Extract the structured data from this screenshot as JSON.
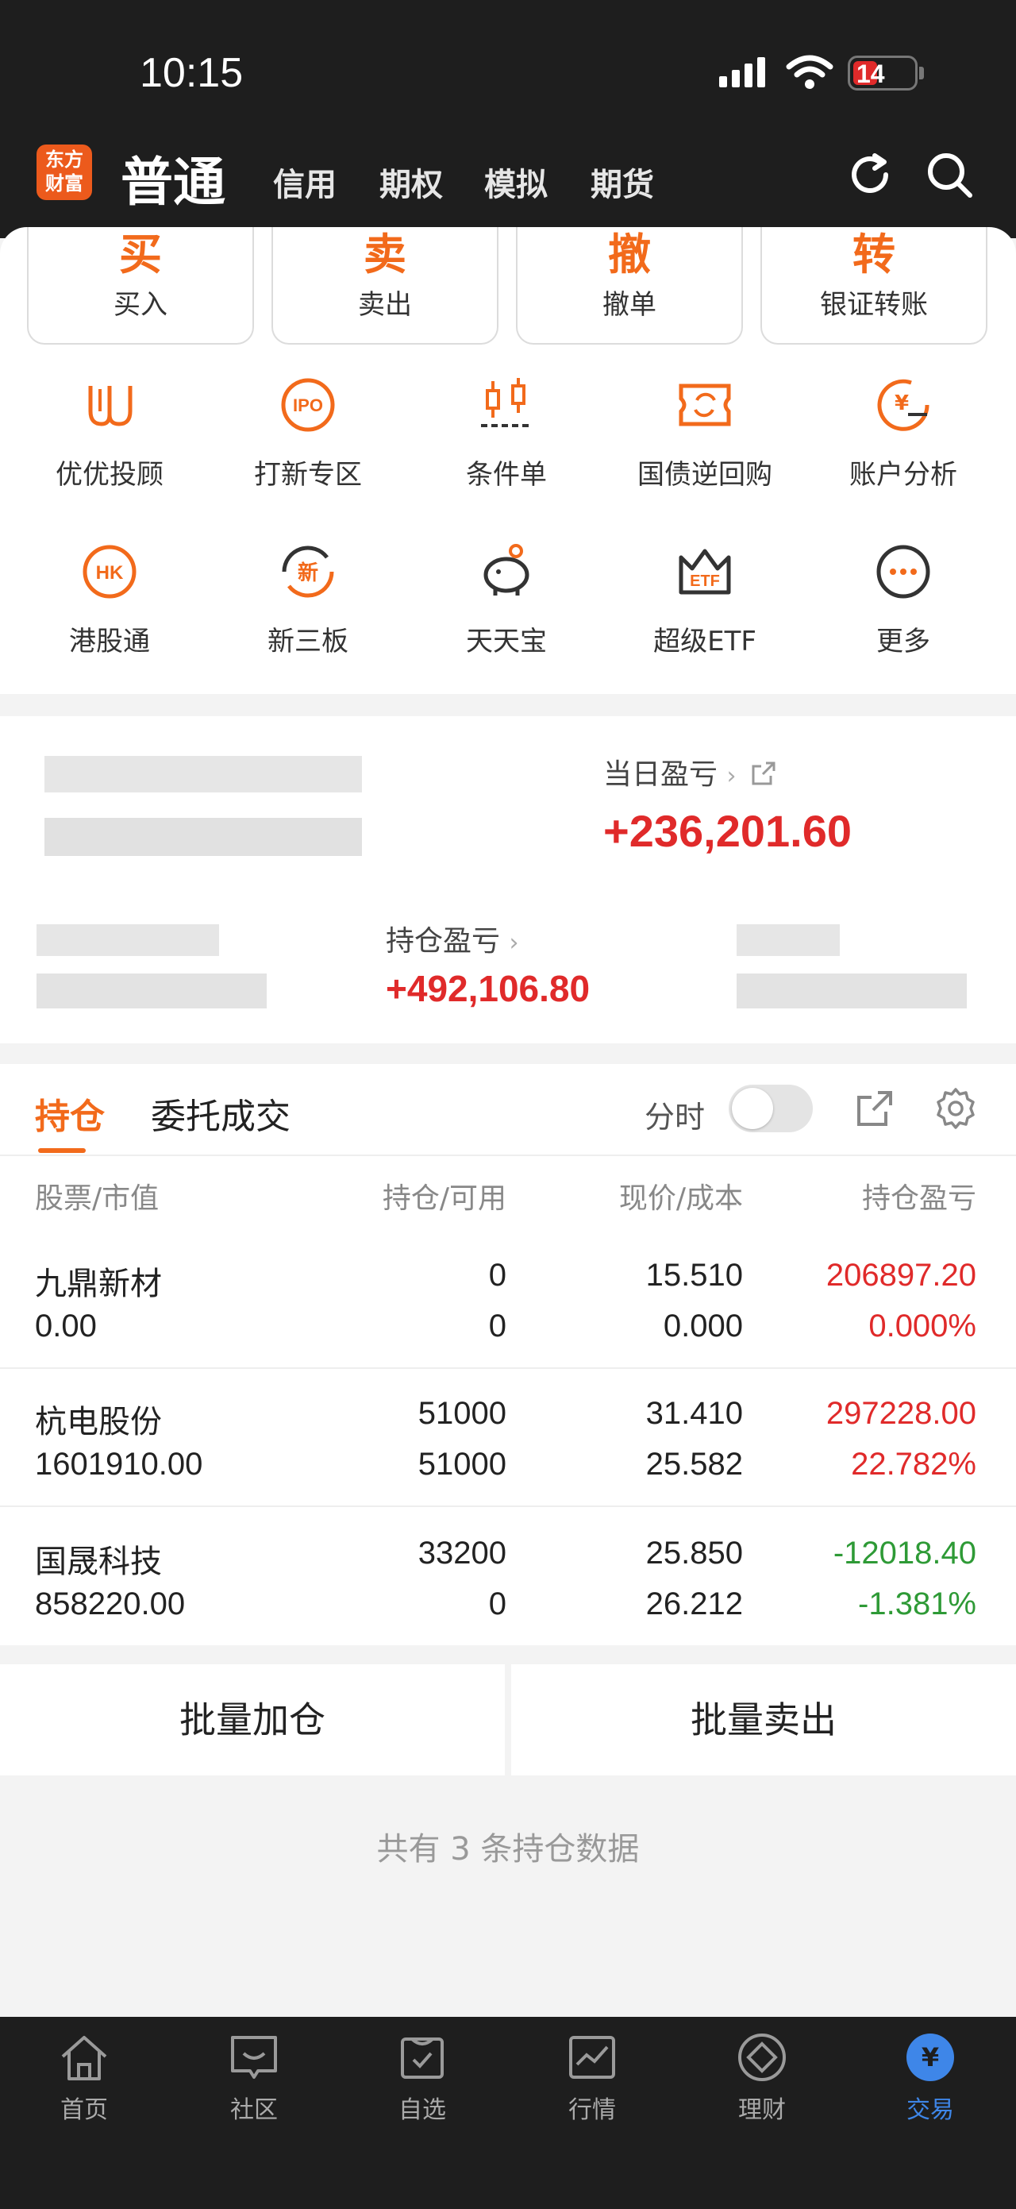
{
  "status_bar": {
    "time": "10:15",
    "battery": "14"
  },
  "header": {
    "logo": [
      "东方",
      "财富"
    ],
    "active": "普通",
    "tabs": [
      "信用",
      "期权",
      "模拟",
      "期货"
    ]
  },
  "trade_buttons": [
    {
      "big": "买",
      "label": "买入"
    },
    {
      "big": "卖",
      "label": "卖出"
    },
    {
      "big": "撤",
      "label": "撤单"
    },
    {
      "big": "转",
      "label": "银证转账"
    }
  ],
  "features": [
    {
      "label": "优优投顾",
      "icon": "uu-advisor-icon"
    },
    {
      "label": "打新专区",
      "icon": "ipo-icon"
    },
    {
      "label": "条件单",
      "icon": "candlestick-icon"
    },
    {
      "label": "国债逆回购",
      "icon": "repo-icon"
    },
    {
      "label": "账户分析",
      "icon": "yuan-chart-icon"
    },
    {
      "label": "港股通",
      "icon": "hk-icon"
    },
    {
      "label": "新三板",
      "icon": "new-board-icon"
    },
    {
      "label": "天天宝",
      "icon": "piggy-bank-icon"
    },
    {
      "label": "超级ETF",
      "icon": "etf-crown-icon"
    },
    {
      "label": "更多",
      "icon": "more-icon"
    }
  ],
  "account": {
    "daily_pl_label": "当日盈亏",
    "daily_pl_value": "+236,201.60",
    "position_pl_label": "持仓盈亏",
    "position_pl_value": "+492,106.80"
  },
  "holdings": {
    "tabs": [
      "持仓",
      "委托成交"
    ],
    "fenshi_label": "分时",
    "columns": [
      "股票/市值",
      "持仓/可用",
      "现价/成本",
      "持仓盈亏"
    ],
    "rows": [
      {
        "name": "九鼎新材",
        "mv": "0.00",
        "hold": "0",
        "avail": "0",
        "price": "15.510",
        "cost": "0.000",
        "pl": "206897.20",
        "pct": "0.000%",
        "color": "#e02a2a"
      },
      {
        "name": "杭电股份",
        "mv": "1601910.00",
        "hold": "51000",
        "avail": "51000",
        "price": "31.410",
        "cost": "25.582",
        "pl": "297228.00",
        "pct": "22.782%",
        "color": "#e02a2a"
      },
      {
        "name": "国晟科技",
        "mv": "858220.00",
        "hold": "33200",
        "avail": "0",
        "price": "25.850",
        "cost": "26.212",
        "pl": "-12018.40",
        "pct": "-1.381%",
        "color": "#2e9a36"
      }
    ],
    "batch_add": "批量加仓",
    "batch_sell": "批量卖出",
    "summary": "共有 3 条持仓数据"
  },
  "bottom_nav": [
    {
      "label": "首页",
      "icon": "home-icon"
    },
    {
      "label": "社区",
      "icon": "community-icon"
    },
    {
      "label": "自选",
      "icon": "watchlist-icon"
    },
    {
      "label": "行情",
      "icon": "market-icon"
    },
    {
      "label": "理财",
      "icon": "wealth-icon"
    },
    {
      "label": "交易",
      "icon": "trade-yuan-icon",
      "active": true
    }
  ],
  "colors": {
    "accent": "#f26a1b",
    "up": "#e02a2a",
    "down": "#2e9a36",
    "nav_active": "#3e86e8"
  }
}
